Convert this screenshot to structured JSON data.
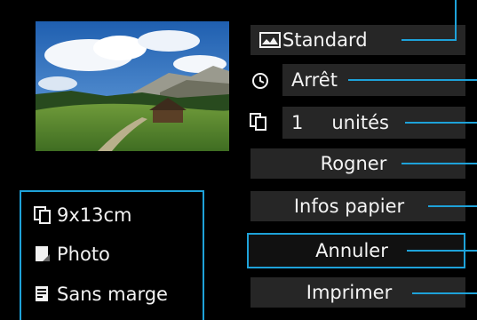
{
  "info": {
    "size": "9x13cm",
    "type": "Photo",
    "border": "Sans marge"
  },
  "menu": {
    "layout": "Standard",
    "date": "Arrêt",
    "copies_count": "1",
    "copies_unit": "unités",
    "trim": "Rogner",
    "paper_info": "Infos papier",
    "cancel": "Annuler",
    "print": "Imprimer"
  },
  "colors": {
    "accent": "#1ea2d9",
    "button_bg": "#262626"
  },
  "icons": {
    "layout": "layout-icon",
    "date": "date-icon",
    "copies": "copies-icon",
    "size": "paper-size-icon",
    "type": "paper-type-icon",
    "border": "border-layout-icon"
  }
}
